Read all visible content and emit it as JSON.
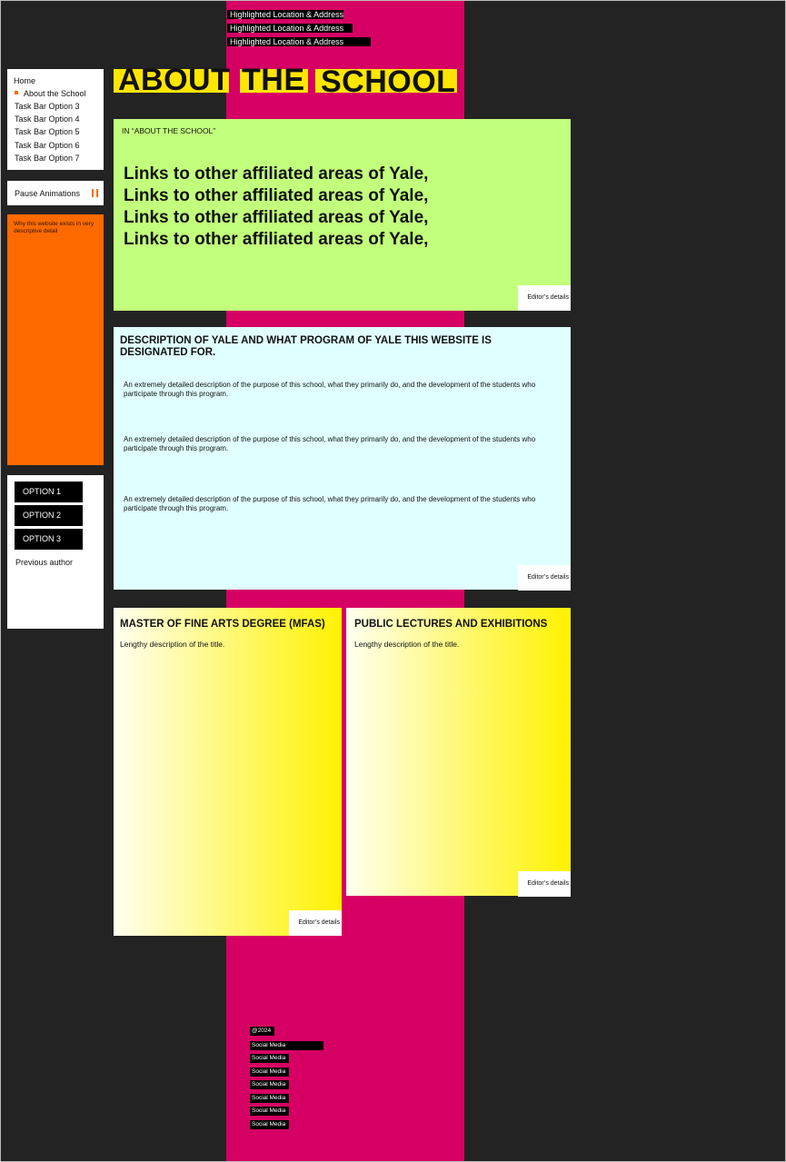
{
  "header": {
    "addresses": [
      "Highlighted Location & Address",
      "Highlighted Location & Address",
      "Highlighted Location & Address"
    ]
  },
  "nav": {
    "items": [
      {
        "label": "Home"
      },
      {
        "label": "About the School",
        "active": true
      },
      {
        "label": "Task Bar Option 3"
      },
      {
        "label": "Task Bar Option 4"
      },
      {
        "label": "Task Bar Option 5"
      },
      {
        "label": "Task Bar Option 6"
      },
      {
        "label": "Task Bar Option 7"
      }
    ],
    "pause_label": "Pause Animations"
  },
  "sidebar": {
    "why_text": "Why this website exists in very descriptive detail",
    "options": [
      "OPTION 1",
      "OPTION 2",
      "OPTION 3"
    ],
    "previous_author": "Previous author"
  },
  "page_title": {
    "words": [
      "ABOUT",
      "THE",
      "SCHOOL"
    ]
  },
  "links_panel": {
    "kicker": "IN “ABOUT THE SCHOOL”",
    "links": [
      "Links to other affiliated areas of Yale,",
      "Links to other affiliated areas of Yale,",
      "Links to other affiliated areas of Yale,",
      "Links to other affiliated areas of Yale,"
    ],
    "editor_label": "Editor’s details"
  },
  "description_panel": {
    "heading": "DESCRIPTION OF YALE AND WHAT PROGRAM OF YALE THIS WEBSITE IS DESIGNATED FOR.",
    "paragraphs": [
      "An extremely detailed description of the purpose of this school, what they primarily do, and the development of the students who participate through this program.",
      "An extremely detailed description of the purpose of this school, what they primarily do, and the development of the students who participate through this program.",
      "An extremely detailed description of the purpose of this school, what they primarily do, and the development of the students who participate through this program."
    ],
    "editor_label": "Editor’s details"
  },
  "cards": [
    {
      "heading": "MASTER OF FINE ARTS DEGREE (MFAS)",
      "description": "Lengthy description of the title.",
      "editor_label": "Editor’s details"
    },
    {
      "heading": "PUBLIC LECTURES AND EXHIBITIONS",
      "description": "Lengthy description of the title.",
      "editor_label": "Editor’s details"
    }
  ],
  "footer": {
    "copyright": "@2024",
    "social": [
      "Social Media",
      "Social Media",
      "Social Media",
      "Social Media",
      "Social Media",
      "Social Media",
      "Social Media"
    ]
  },
  "colors": {
    "background": "#232323",
    "band": "#d60064",
    "accent_orange": "#ff6a00",
    "title_yellow": "#ffe600",
    "links_green": "#c2ff7c",
    "description_cyan": "#e0ffff"
  }
}
